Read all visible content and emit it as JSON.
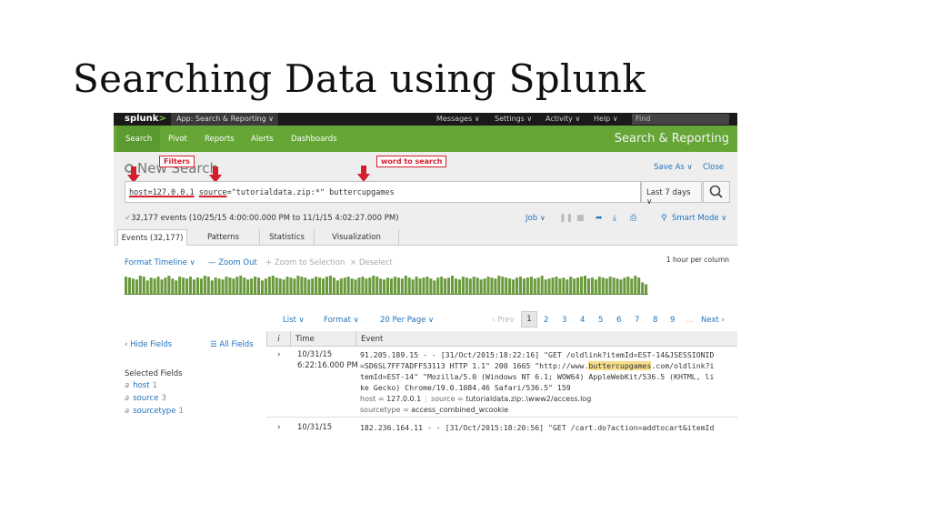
{
  "slide": {
    "title": "Searching Data using Splunk"
  },
  "topbar": {
    "logo": "splunk",
    "logo_suffix": ">",
    "app_menu": "App: Search & Reporting ∨",
    "menus": [
      "Messages ∨",
      "Settings ∨",
      "Activity ∨",
      "Help ∨"
    ],
    "find_placeholder": "Find"
  },
  "nav": {
    "items": [
      "Search",
      "Pivot",
      "Reports",
      "Alerts",
      "Dashboards"
    ],
    "app_title": "Search & Reporting"
  },
  "header": {
    "page_title": "New Search",
    "save_as": "Save As ∨",
    "close": "Close"
  },
  "annotations": {
    "filters_label": "Filters",
    "word_label": "word to search"
  },
  "search": {
    "host_term": "host=127.0.0.1",
    "source_key": "source",
    "rest": "=\"tutorialdata.zip:*\" buttercupgames",
    "time_range": "Last 7 days ∨"
  },
  "status": {
    "events_text": "32,177 events (10/25/15 4:00:00.000 PM to 11/1/15 4:02:27.000 PM)",
    "job": "Job ∨",
    "smart_mode": "Smart Mode ∨"
  },
  "tabs": [
    "Events (32,177)",
    "Patterns",
    "Statistics",
    "Visualization"
  ],
  "timeline": {
    "format": "Format Timeline ∨",
    "zoom_out": "— Zoom Out",
    "zoom_selection": "+ Zoom to Selection",
    "deselect": "× Deselect",
    "scale": "1 hour per column",
    "levels": [
      0.9,
      0.85,
      0.8,
      0.75,
      0.95,
      0.9,
      0.7,
      0.85,
      0.8,
      0.9,
      0.75,
      0.85,
      0.95,
      0.8,
      0.7,
      0.9,
      0.85,
      0.8,
      0.9,
      0.75,
      0.85,
      0.8,
      0.95,
      0.9,
      0.7,
      0.85,
      0.8,
      0.75,
      0.9,
      0.85,
      0.8,
      0.9,
      0.95,
      0.85,
      0.75,
      0.8,
      0.9,
      0.85,
      0.7,
      0.8,
      0.9,
      0.95,
      0.85,
      0.8,
      0.75,
      0.9,
      0.85,
      0.8,
      0.95,
      0.9,
      0.85,
      0.75,
      0.8,
      0.9,
      0.85,
      0.8,
      0.9,
      0.95,
      0.85,
      0.7,
      0.8,
      0.85,
      0.9,
      0.8,
      0.75,
      0.85,
      0.9,
      0.8,
      0.85,
      0.95,
      0.9,
      0.8,
      0.75,
      0.85,
      0.8,
      0.9,
      0.85,
      0.8,
      0.95,
      0.85,
      0.75,
      0.9,
      0.8,
      0.85,
      0.9,
      0.8,
      0.7,
      0.85,
      0.9,
      0.8,
      0.85,
      0.95,
      0.8,
      0.75,
      0.9,
      0.85,
      0.8,
      0.9,
      0.85,
      0.75,
      0.8,
      0.9,
      0.85,
      0.8,
      0.95,
      0.9,
      0.85,
      0.8,
      0.75,
      0.85,
      0.9,
      0.8,
      0.85,
      0.9,
      0.8,
      0.85,
      0.95,
      0.75,
      0.8,
      0.85,
      0.9,
      0.8,
      0.85,
      0.75,
      0.9,
      0.8,
      0.85,
      0.9,
      0.95,
      0.8,
      0.85,
      0.75,
      0.9,
      0.85,
      0.8,
      0.9,
      0.85,
      0.8,
      0.75,
      0.85,
      0.9,
      0.8,
      0.95,
      0.85,
      0.6,
      0.5
    ]
  },
  "pager": {
    "list": "List ∨",
    "format": "Format ∨",
    "per_page": "20 Per Page ∨",
    "prev": "‹ Prev",
    "pages": [
      "1",
      "2",
      "3",
      "4",
      "5",
      "6",
      "7",
      "8",
      "9"
    ],
    "ellipsis": "...",
    "next": "Next ›"
  },
  "fields": {
    "hide": "‹ Hide Fields",
    "all": "☰ All Fields",
    "selected_heading": "Selected Fields",
    "selected": [
      {
        "type": "a",
        "name": "host",
        "count": "1"
      },
      {
        "type": "a",
        "name": "source",
        "count": "3"
      },
      {
        "type": "a",
        "name": "sourcetype",
        "count": "1"
      }
    ]
  },
  "table": {
    "col_i": "i",
    "col_time": "Time",
    "col_event": "Event",
    "rows": [
      {
        "date": "10/31/15",
        "time": "6:22:16.000 PM",
        "line1": "91.205.189.15 - - [31/Oct/2015:18:22:16] \"GET /oldlink?itemId=EST-14&JSESSIONID",
        "line2": "=SD6SL7FF7ADFF53113 HTTP 1.1\" 200 1665 \"http://www.",
        "highlight": "buttercupgames",
        "line2b": ".com/oldlink?i",
        "line3": "temId=EST-14\" \"Mozilla/5.0 (Windows NT 6.1; WOW64) AppleWebKit/536.5 (KHTML, li",
        "line4": "ke Gecko) Chrome/19.0.1084.46 Safari/536.5\" 159",
        "host_label": "host =",
        "host_val": "127.0.0.1",
        "source_label": "source =",
        "source_val": "tutorialdata.zip:.\\www2/access.log",
        "st_label": "sourcetype =",
        "st_val": "access_combined_wcookie"
      },
      {
        "date": "10/31/15",
        "line1": "182.236.164.11 - - [31/Oct/2015:18:20:56] \"GET /cart.do?action=addtocart&itemId"
      }
    ]
  },
  "colors": {
    "green_nav": "#65a637",
    "link": "#1e73be",
    "annotation_red": "#d21f2b",
    "highlight": "#f6de8b"
  }
}
